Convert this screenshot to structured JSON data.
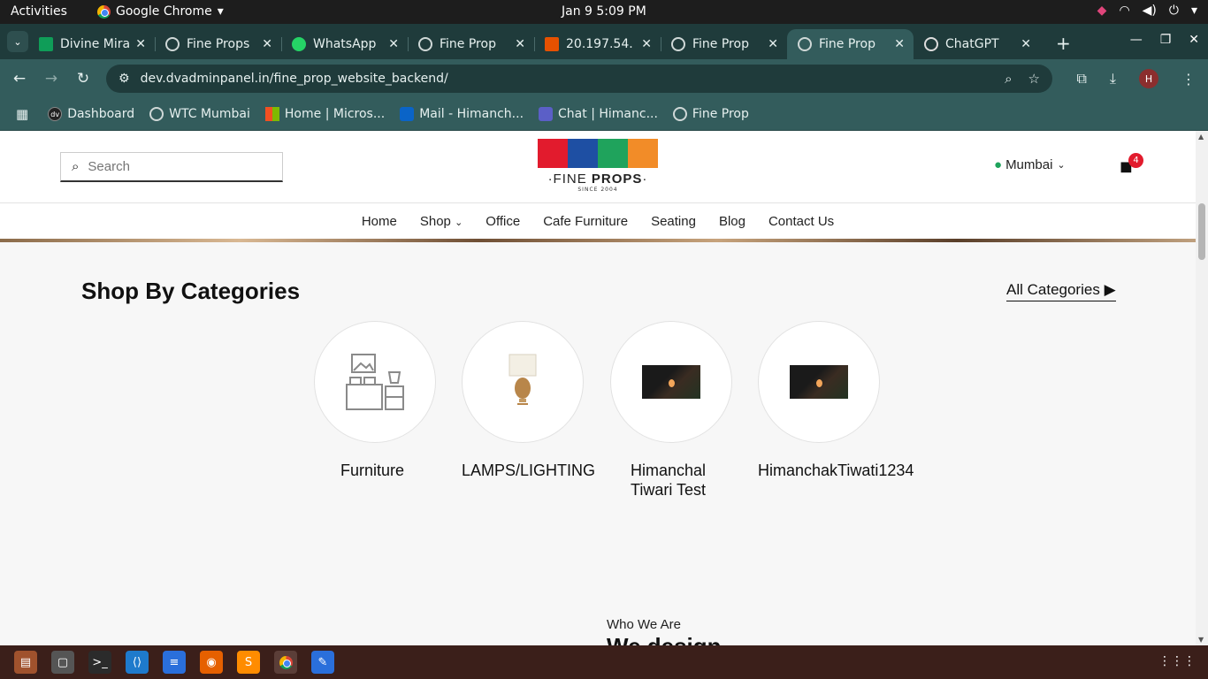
{
  "system": {
    "activities": "Activities",
    "app_name": "Google Chrome",
    "clock": "Jan 9   5:09 PM"
  },
  "tabs": [
    {
      "title": "Divine Mira",
      "icon": "sheets-icon"
    },
    {
      "title": "Fine Props",
      "icon": "globe-icon"
    },
    {
      "title": "WhatsApp",
      "icon": "whatsapp-icon"
    },
    {
      "title": "Fine Prop",
      "icon": "globe-icon"
    },
    {
      "title": "20.197.54.",
      "icon": "server-icon"
    },
    {
      "title": "Fine Prop",
      "icon": "globe-icon"
    },
    {
      "title": "Fine Prop",
      "icon": "globe-icon",
      "active": true
    },
    {
      "title": "ChatGPT",
      "icon": "chatgpt-icon"
    }
  ],
  "address_bar": {
    "url": "dev.dvadminpanel.in/fine_prop_website_backend/"
  },
  "profile_initial": "H",
  "bookmarks": [
    {
      "label": "Dashboard",
      "icon": "dv"
    },
    {
      "label": "WTC Mumbai",
      "icon": "globe"
    },
    {
      "label": "Home | Micros...",
      "icon": "ms"
    },
    {
      "label": "Mail - Himanch...",
      "icon": "ol"
    },
    {
      "label": "Chat | Himanc...",
      "icon": "tm"
    },
    {
      "label": "Fine Prop",
      "icon": "globe"
    }
  ],
  "site": {
    "search_placeholder": "Search",
    "logo_brand_light": "·FINE ",
    "logo_brand_bold": "PROPS",
    "logo_brand_end": "·",
    "logo_since": "SINCE 2004",
    "location": "Mumbai",
    "cart_count": "4",
    "nav": [
      "Home",
      "Shop",
      "Office",
      "Cafe Furniture",
      "Seating",
      "Blog",
      "Contact Us"
    ],
    "section_title": "Shop By Categories",
    "all_categories": "All Categories",
    "categories": [
      {
        "label": "Furniture",
        "image": "furniture-icon"
      },
      {
        "label": "LAMPS/LIGHTING",
        "image": "lamp-image"
      },
      {
        "label": "Himanchal Tiwari Test",
        "image": "candle-image"
      },
      {
        "label": "HimanchakTiwati1234",
        "image": "candle-image"
      }
    ],
    "who_we_are": "Who We Are",
    "who_heading": "We design"
  },
  "colors": {
    "tab_strip": "#1f3b3b",
    "toolbar": "#335c5c",
    "cart_badge": "#e21b2d",
    "pin": "#1fa35c",
    "taskbar": "#3b1f1a"
  }
}
